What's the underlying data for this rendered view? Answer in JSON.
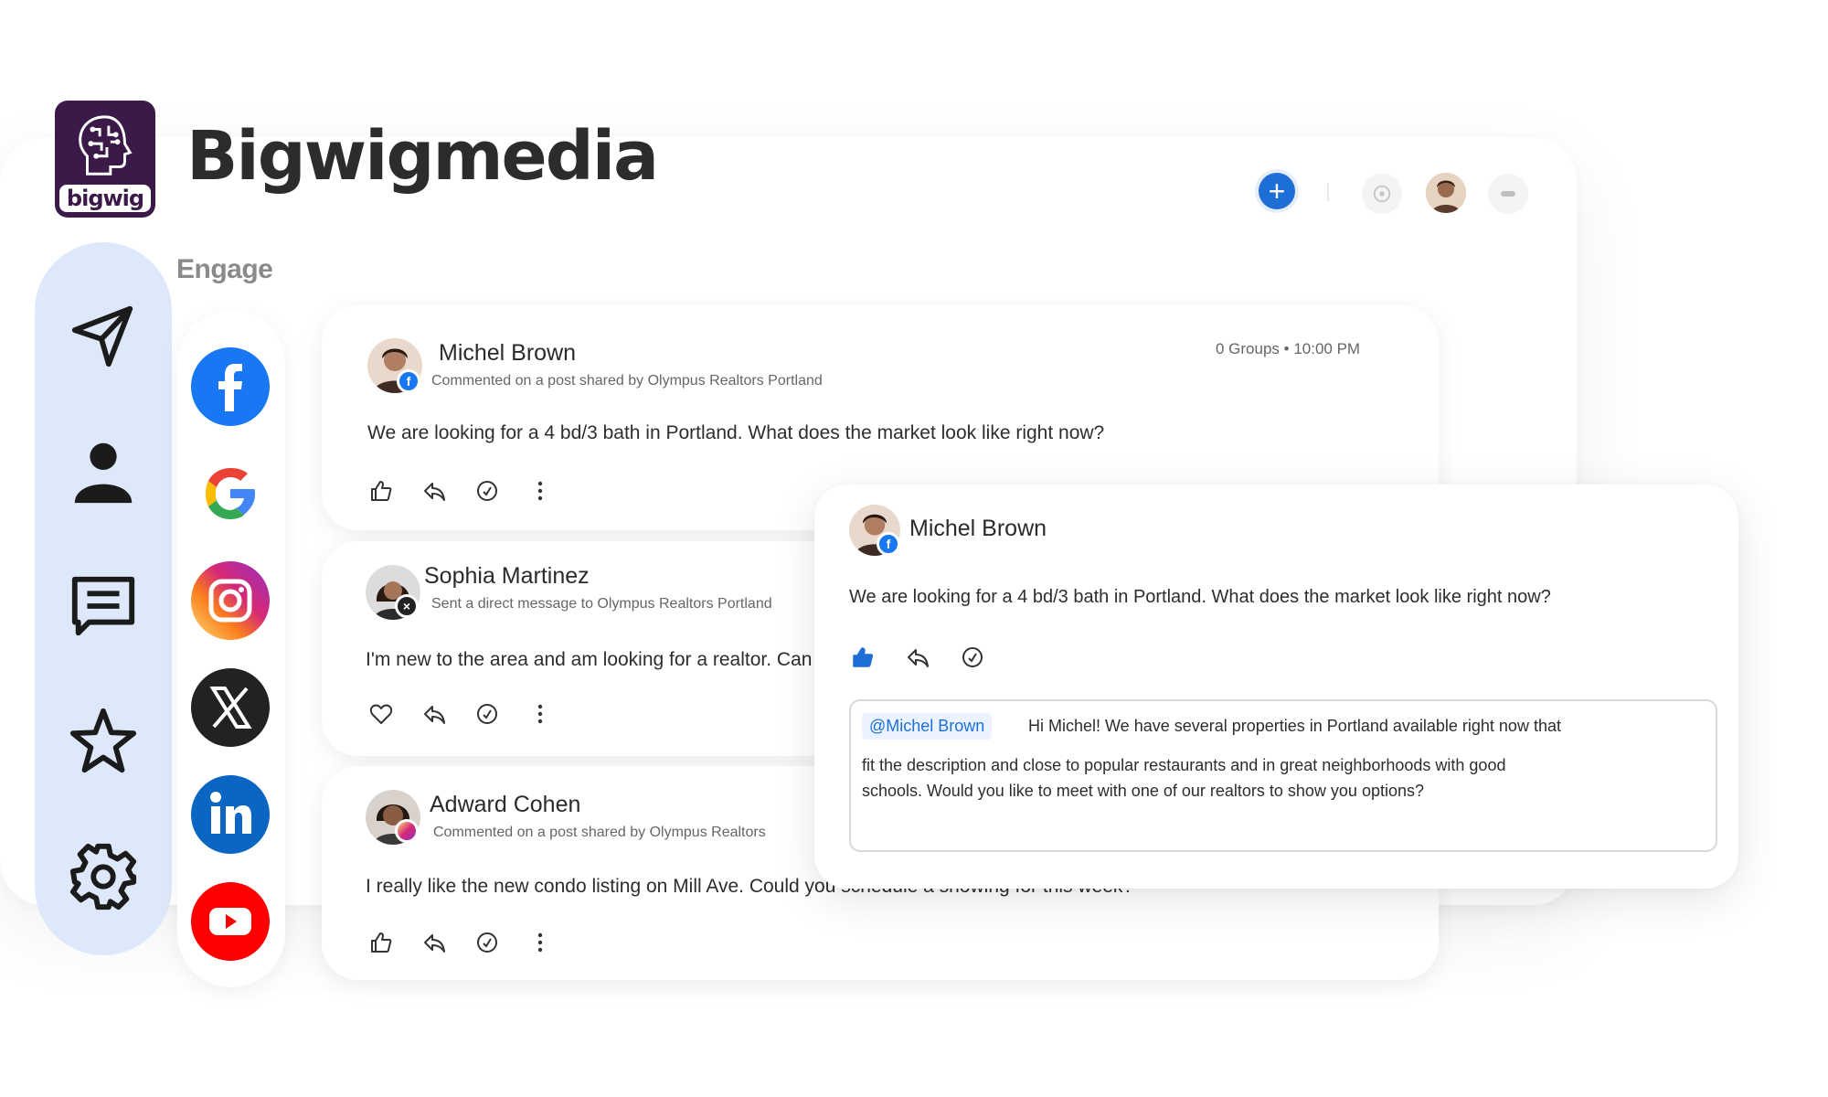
{
  "brand": {
    "name": "Bigwigmedia",
    "logo_word": "bigwig"
  },
  "section_label": "Engage",
  "header": {
    "add_icon": "plus-icon",
    "eye_icon": "eye-icon",
    "more_icon": "more-icon",
    "accent": "#1d6fd6"
  },
  "nav": {
    "items": [
      {
        "name": "send",
        "icon": "paper-plane-icon"
      },
      {
        "name": "contacts",
        "icon": "user-icon"
      },
      {
        "name": "messages",
        "icon": "message-icon"
      },
      {
        "name": "favorites",
        "icon": "star-icon"
      },
      {
        "name": "settings",
        "icon": "gear-icon"
      }
    ],
    "background": "#dde9fb"
  },
  "platforms": [
    {
      "name": "facebook",
      "icon": "facebook-icon",
      "color": "#1877f2"
    },
    {
      "name": "google",
      "icon": "google-icon",
      "color": "#4285f4"
    },
    {
      "name": "instagram",
      "icon": "instagram-icon",
      "color": "#d62976"
    },
    {
      "name": "x",
      "icon": "x-icon",
      "color": "#222222"
    },
    {
      "name": "linkedin",
      "icon": "linkedin-icon",
      "color": "#0a66c2"
    },
    {
      "name": "youtube",
      "icon": "youtube-icon",
      "color": "#ff0000"
    }
  ],
  "posts": [
    {
      "author": "Michel Brown",
      "subtitle": "Commented on a post shared by Olympus Realtors Portland",
      "time": "0 Groups • 10:00 PM",
      "text": "We are looking for a 4 bd/3 bath in Portland. What does the market look like right now?",
      "platform_badge": "facebook"
    },
    {
      "author": "Sophia Martinez",
      "subtitle": "Sent a direct message to Olympus Realtors Portland",
      "text": "I'm new to the area and am looking for a realtor. Can you help?",
      "platform_badge": "x"
    },
    {
      "author": "Adward Cohen",
      "subtitle": "Commented on a post shared by Olympus Realtors",
      "text": "I really like the new condo listing on Mill Ave. Could you schedule a showing for this week?",
      "platform_badge": "instagram"
    }
  ],
  "popup": {
    "author": "Michel Brown",
    "text": "We are looking for a 4 bd/3 bath in Portland. What does the market look like right now?",
    "reply": {
      "mention": "@Michel Brown",
      "line1": "Hi Michel! We have several properties in Portland available right now that",
      "line2": "fit the description and close to popular restaurants and in great neighborhoods with good",
      "line3": "schools. Would you like to meet with one of our realtors to show you options?"
    }
  }
}
